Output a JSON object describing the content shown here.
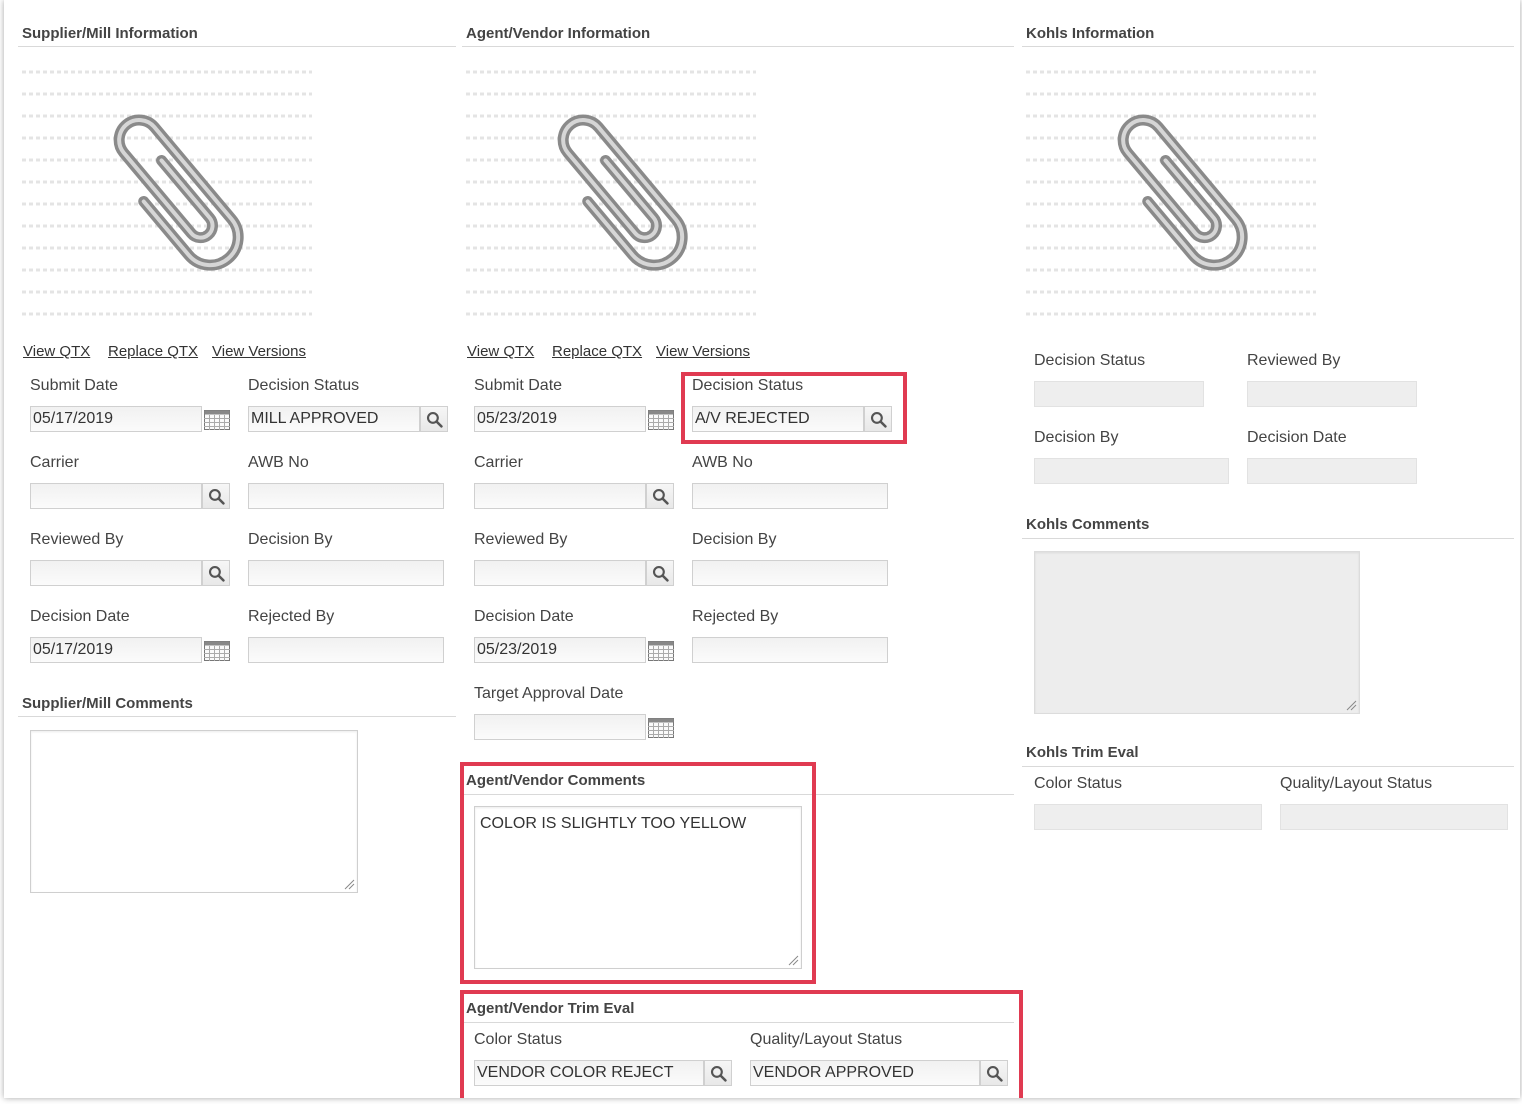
{
  "supplier": {
    "title": "Supplier/Mill Information",
    "links": [
      "View QTX",
      "Replace QTX",
      "View Versions"
    ],
    "submit_date_label": "Submit Date",
    "submit_date": "05/17/2019",
    "decision_status_label": "Decision Status",
    "decision_status": "MILL APPROVED",
    "carrier_label": "Carrier",
    "carrier": "",
    "awb_label": "AWB No",
    "awb": "",
    "reviewed_by_label": "Reviewed By",
    "reviewed_by": "",
    "decision_by_label": "Decision By",
    "decision_by": "",
    "decision_date_label": "Decision Date",
    "decision_date": "05/17/2019",
    "rejected_by_label": "Rejected By",
    "rejected_by": "",
    "comments_title": "Supplier/Mill Comments",
    "comments": ""
  },
  "agent": {
    "title": "Agent/Vendor Information",
    "links": [
      "View QTX",
      "Replace QTX",
      "View Versions"
    ],
    "submit_date_label": "Submit Date",
    "submit_date": "05/23/2019",
    "decision_status_label": "Decision Status",
    "decision_status": "A/V REJECTED",
    "carrier_label": "Carrier",
    "carrier": "",
    "awb_label": "AWB No",
    "awb": "",
    "reviewed_by_label": "Reviewed By",
    "reviewed_by": "",
    "decision_by_label": "Decision By",
    "decision_by": "",
    "decision_date_label": "Decision Date",
    "decision_date": "05/23/2019",
    "rejected_by_label": "Rejected By",
    "rejected_by": "",
    "target_approval_label": "Target Approval Date",
    "target_approval": "",
    "comments_title": "Agent/Vendor Comments",
    "comments": "COLOR IS SLIGHTLY TOO YELLOW",
    "trim_title": "Agent/Vendor Trim Eval",
    "color_status_label": "Color Status",
    "color_status": "VENDOR COLOR REJECT",
    "quality_status_label": "Quality/Layout Status",
    "quality_status": "VENDOR APPROVED"
  },
  "kohls": {
    "title": "Kohls Information",
    "decision_status_label": "Decision Status",
    "reviewed_by_label": "Reviewed By",
    "decision_by_label": "Decision By",
    "decision_date_label": "Decision Date",
    "comments_title": "Kohls Comments",
    "trim_title": "Kohls Trim Eval",
    "color_status_label": "Color Status",
    "quality_status_label": "Quality/Layout Status"
  },
  "colors": {
    "highlight": "#e03a51"
  },
  "icons": [
    "paperclip-icon",
    "search-icon",
    "calendar-icon",
    "resize-grip-icon"
  ]
}
